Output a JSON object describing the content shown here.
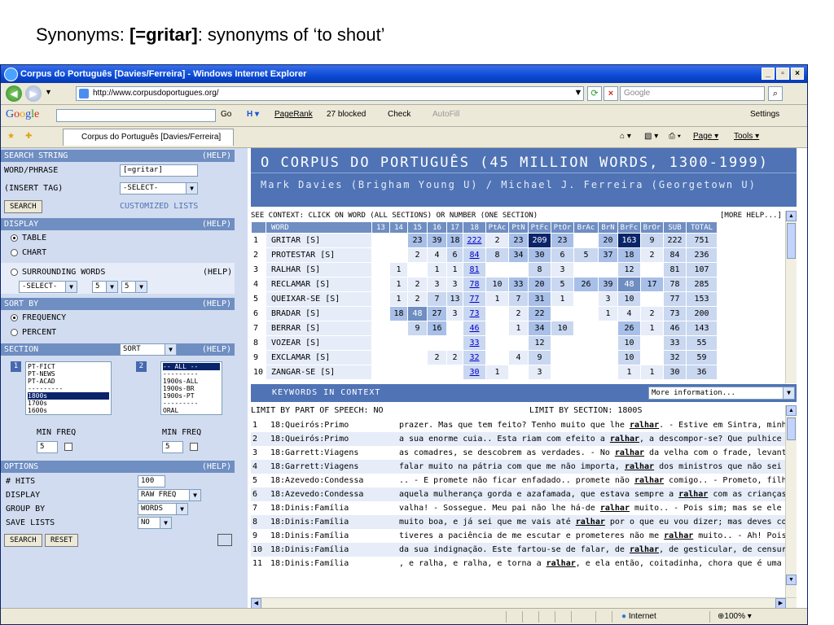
{
  "slide": {
    "title_prefix": "Synonyms: ",
    "title_bold": "[=gritar]",
    "title_suffix": ": synonyms of ‘to shout’"
  },
  "window": {
    "title": "Corpus do Português [Davies/Ferreira] - Windows Internet Explorer"
  },
  "address": {
    "url": "http://www.corpusdoportugues.org/",
    "search_placeholder": "Google"
  },
  "google_bar": {
    "logo": "Google",
    "go": "Go",
    "pagerank": "PageRank",
    "blocked": "27 blocked",
    "check": "Check",
    "autofill": "AutoFill",
    "settings": "Settings"
  },
  "tab": {
    "label": "Corpus do Português [Davies/Ferreira]",
    "page": "Page",
    "tools": "Tools"
  },
  "left": {
    "search_string": "SEARCH STRING",
    "help": "(HELP)",
    "word_phrase": "WORD/PHRASE",
    "word_value": "[=gritar]",
    "insert_tag": "(INSERT TAG)",
    "select": "-SELECT-",
    "search_btn": "SEARCH",
    "customized": "CUSTOMIZED LISTS",
    "display": "DISPLAY",
    "table": "TABLE",
    "chart": "CHART",
    "surrounding": "SURROUNDING WORDS",
    "num5a": "5",
    "num5b": "5",
    "sort_by": "SORT BY",
    "frequency": "FREQUENCY",
    "percent": "PERCENT",
    "section": "SECTION",
    "sort": "SORT",
    "list1_num": "1",
    "list2_num": "2",
    "list1": [
      "PT-FICT",
      "PT-NEWS",
      "PT-ACAD",
      "---------",
      "1800s",
      "1700s",
      "1600s"
    ],
    "list2": [
      "-- ALL --",
      "---------",
      "1900s-ALL",
      "1900s-BR",
      "1900s-PT",
      "---------",
      "ORAL"
    ],
    "min_freq": "MIN FREQ",
    "min1": "5",
    "min2": "5",
    "options": "OPTIONS",
    "hits": "# HITS",
    "hits_val": "100",
    "display_opt": "DISPLAY",
    "display_val": "RAW FREQ",
    "group_by": "GROUP BY",
    "group_val": "WORDS",
    "save_lists": "SAVE LISTS",
    "save_val": "NO",
    "search2": "SEARCH",
    "reset": "RESET"
  },
  "banner": {
    "title": "O CORPUS DO PORTUGUÊS (45 MILLION WORDS, 1300-1999)",
    "authors": "Mark Davies (Brigham Young U) / Michael J. Ferreira (Georgetown U)"
  },
  "freq": {
    "context_note": "SEE CONTEXT: CLICK ON WORD (ALL SECTIONS) OR NUMBER (ONE SECTION)",
    "more_help": "[MORE HELP...]",
    "headers": [
      "",
      "WORD",
      "13",
      "14",
      "15",
      "16",
      "17",
      "18",
      "PtAc",
      "PtN",
      "PtFc",
      "PtOr",
      "BrAc",
      "BrN",
      "BrFc",
      "BrOr",
      "SUB",
      "TOTAL"
    ],
    "rows": [
      [
        "1",
        "GRITAR [S]",
        "",
        "",
        "23",
        "39",
        "18",
        "222",
        "2",
        "23",
        "209",
        "23",
        "",
        "20",
        "163",
        "9",
        "222",
        "751"
      ],
      [
        "2",
        "PROTESTAR [S]",
        "",
        "",
        "2",
        "4",
        "6",
        "84",
        "8",
        "34",
        "30",
        "6",
        "5",
        "37",
        "18",
        "2",
        "84",
        "236"
      ],
      [
        "3",
        "RALHAR [S]",
        "",
        "1",
        "",
        "1",
        "1",
        "81",
        "",
        "",
        "8",
        "3",
        "",
        "",
        "12",
        "",
        "81",
        "107"
      ],
      [
        "4",
        "RECLAMAR [S]",
        "",
        "1",
        "2",
        "3",
        "3",
        "78",
        "10",
        "33",
        "20",
        "5",
        "26",
        "39",
        "48",
        "17",
        "78",
        "285"
      ],
      [
        "5",
        "QUEIXAR-SE [S]",
        "",
        "1",
        "2",
        "7",
        "13",
        "77",
        "1",
        "7",
        "31",
        "1",
        "",
        "3",
        "10",
        "",
        "77",
        "153"
      ],
      [
        "6",
        "BRADAR [S]",
        "",
        "18",
        "48",
        "27",
        "3",
        "73",
        "",
        "2",
        "22",
        "",
        "",
        "1",
        "4",
        "2",
        "73",
        "200"
      ],
      [
        "7",
        "BERRAR [S]",
        "",
        "",
        "9",
        "16",
        "",
        "46",
        "",
        "1",
        "34",
        "10",
        "",
        "",
        "26",
        "1",
        "46",
        "143"
      ],
      [
        "8",
        "VOZEAR [S]",
        "",
        "",
        "",
        "",
        "",
        "33",
        "",
        "",
        "12",
        "",
        "",
        "",
        "10",
        "",
        "33",
        "55"
      ],
      [
        "9",
        "EXCLAMAR [S]",
        "",
        "",
        "",
        "2",
        "2",
        "32",
        "",
        "4",
        "9",
        "",
        "",
        "",
        "10",
        "",
        "32",
        "59"
      ],
      [
        "10",
        "ZANGAR-SE [S]",
        "",
        "",
        "",
        "",
        "",
        "30",
        "1",
        "",
        "3",
        "",
        "",
        "",
        "1",
        "1",
        "30",
        "36"
      ]
    ]
  },
  "kwic": {
    "bar_label": "KEYWORDS IN CONTEXT",
    "more_info": "More information...",
    "limit_pos": "LIMIT BY PART OF SPEECH: NO",
    "limit_section": "LIMIT BY SECTION:  1800S",
    "rows": [
      {
        "n": "1",
        "src": "18:Queirós:Primo",
        "pre": "prazer. Mas que tem feito? Tenho muito que lhe ",
        "kw": "ralhar",
        "post": ". - Estive em Sintra, minha queric"
      },
      {
        "n": "2",
        "src": "18:Queirós:Primo",
        "pre": "a sua enorme cuia.. Esta riam com efeito a ",
        "kw": "ralhar",
        "post": ", a descompor-se? Que pulhice que er"
      },
      {
        "n": "3",
        "src": "18:Garrett:Viagens",
        "pre": "as comadres, se descobrem as verdades. - No ",
        "kw": "ralhar",
        "post": " da velha com o frade, levanta-se"
      },
      {
        "n": "4",
        "src": "18:Garrett:Viagens",
        "pre": "falar muito na pátria com que me não importa, ",
        "kw": "ralhar",
        "post": " dos ministros que não sei quem s"
      },
      {
        "n": "5",
        "src": "18:Azevedo:Condessa",
        "pre": ".. - E promete não ficar enfadado.. promete não ",
        "kw": "ralhar",
        "post": " comigo.. - Prometo, filha; mas va"
      },
      {
        "n": "6",
        "src": "18:Azevedo:Condessa",
        "pre": "aquela mulherança gorda e azafamada, que estava sempre a ",
        "kw": "ralhar",
        "post": " com as crianças, e"
      },
      {
        "n": "7",
        "src": "18:Dinis:Família",
        "pre": "valha! - Sossegue. Meu pai não lhe há-de ",
        "kw": "ralhar",
        "post": " muito.. - Pois sim; mas se ele tanto me"
      },
      {
        "n": "8",
        "src": "18:Dinis:Família",
        "pre": "muito boa, e já sei que me vais até ",
        "kw": "ralhar",
        "post": " por o que eu vou dizer; mas deves concorda"
      },
      {
        "n": "9",
        "src": "18:Dinis:Família",
        "pre": "tiveres a paciência de me escutar e prometeres não me ",
        "kw": "ralhar",
        "post": " muito.. - Ah! Pois temos"
      },
      {
        "n": "10",
        "src": "18:Dinis:Família",
        "pre": "da sua indignação. Este fartou-se de falar, de ",
        "kw": "ralhar",
        "post": ", de gesticular, de censurar as auto"
      },
      {
        "n": "11",
        "src": "18:Dinis:Família",
        "pre": ", e ralha, e ralha, e torna a ",
        "kw": "ralhar",
        "post": ", e ela então, coitadinha, chora que é uma dor do"
      }
    ]
  },
  "status": {
    "zone": "Internet",
    "zoom": "100%"
  }
}
